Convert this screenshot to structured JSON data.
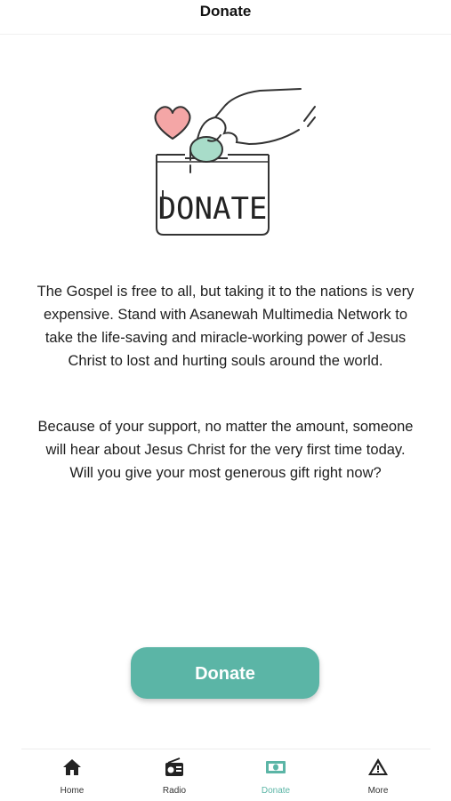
{
  "header": {
    "title": "Donate"
  },
  "illustration": {
    "label": "DONATE",
    "accent": "#5bb5a6",
    "heart_color": "#f4a6a6",
    "coin_color": "#a8dcc9"
  },
  "content": {
    "paragraph_1": "The Gospel is free to all, but taking it to the nations is very expensive. Stand with Asanewah Multimedia Network to take the life-saving and miracle-working power of Jesus Christ to lost and hurting souls around the world.",
    "paragraph_2": "Because of your support, no matter the amount, someone will hear about Jesus Christ for the very first time today. Will you give your most generous gift right now?"
  },
  "cta": {
    "label": "Donate",
    "color": "#5bb5a6"
  },
  "tabbar": {
    "active": "donate",
    "items": [
      {
        "id": "home",
        "label": "Home",
        "icon": "home-icon"
      },
      {
        "id": "radio",
        "label": "Radio",
        "icon": "radio-icon"
      },
      {
        "id": "donate",
        "label": "Donate",
        "icon": "money-icon"
      },
      {
        "id": "more",
        "label": "More",
        "icon": "warning-icon"
      }
    ]
  }
}
